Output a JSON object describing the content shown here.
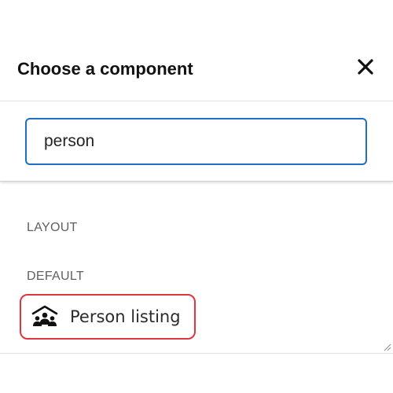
{
  "dialog": {
    "title": "Choose a component",
    "close_icon": "close-icon"
  },
  "search": {
    "value": "person"
  },
  "groups": [
    {
      "label": "LAYOUT"
    },
    {
      "label": "DEFAULT"
    }
  ],
  "results": [
    {
      "label": "Person listing",
      "icon": "person-listing-icon"
    }
  ],
  "colors": {
    "input_border": "#1f6fc5",
    "highlight_border": "#e0353f",
    "group_label": "#5f5f5f"
  }
}
